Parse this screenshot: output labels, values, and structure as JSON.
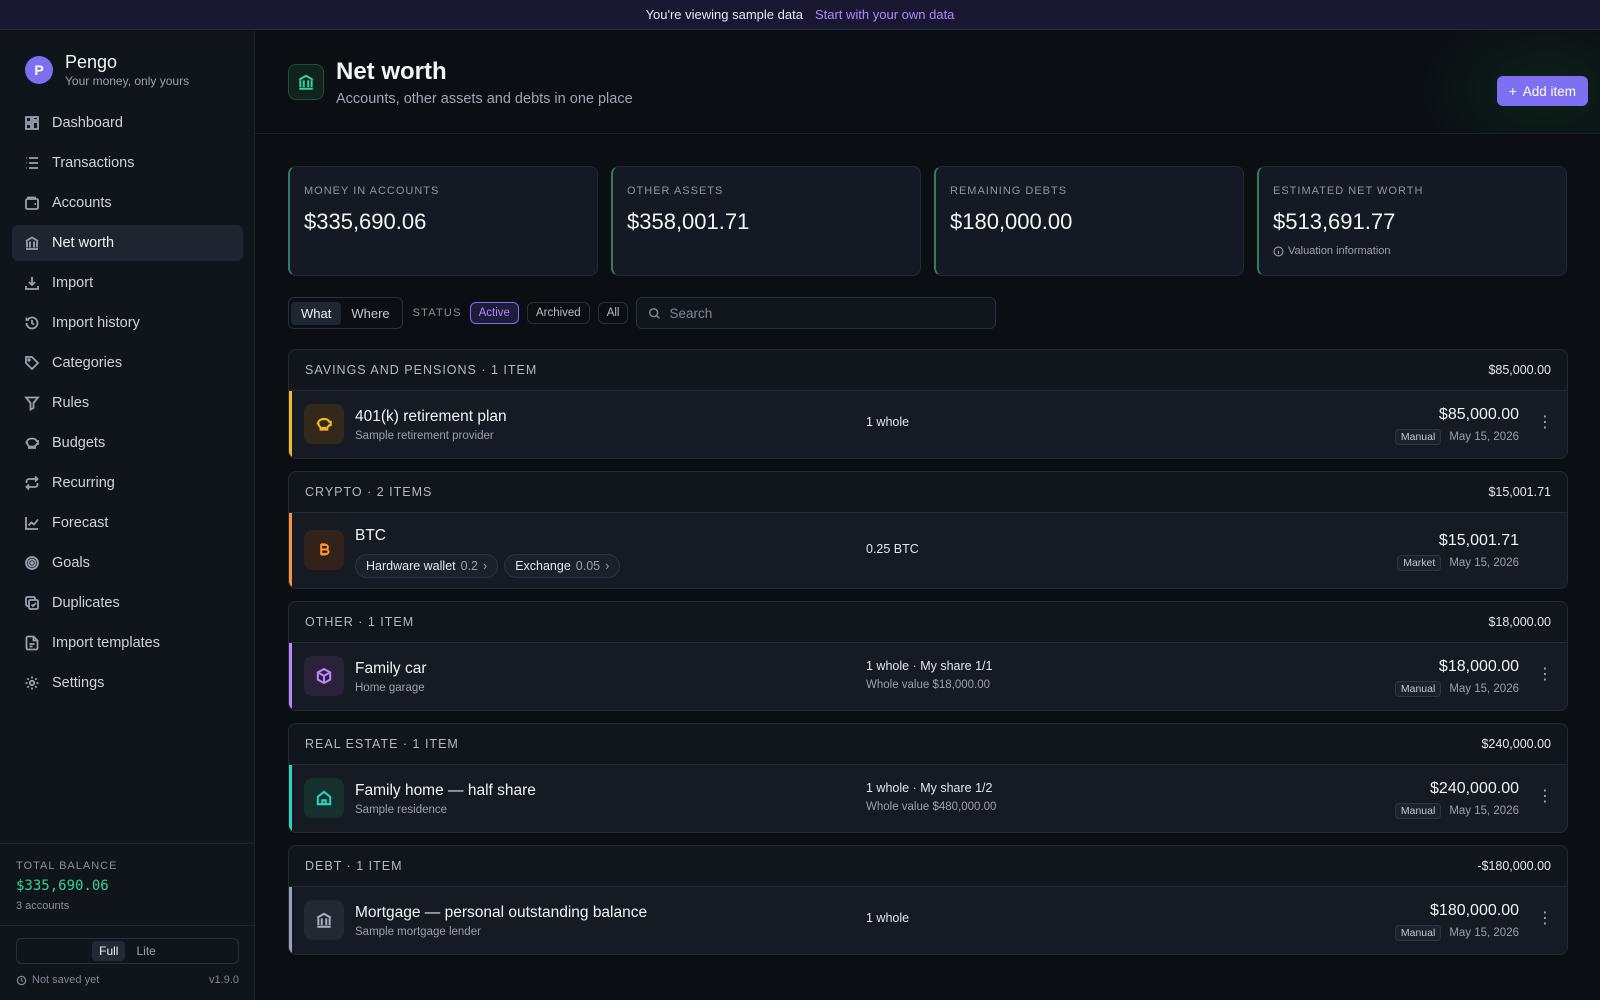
{
  "banner": {
    "text": "You're viewing sample data",
    "link": "Start with your own data"
  },
  "brand": {
    "logo_letter": "P",
    "name": "Pengo",
    "tagline": "Your money, only yours"
  },
  "nav": [
    {
      "label": "Dashboard",
      "icon": "dashboard-icon"
    },
    {
      "label": "Transactions",
      "icon": "list-icon"
    },
    {
      "label": "Accounts",
      "icon": "wallet-icon"
    },
    {
      "label": "Net worth",
      "icon": "bank-icon",
      "active": true
    },
    {
      "label": "Import",
      "icon": "download-icon"
    },
    {
      "label": "Import history",
      "icon": "history-icon"
    },
    {
      "label": "Categories",
      "icon": "tag-icon"
    },
    {
      "label": "Rules",
      "icon": "filter-icon"
    },
    {
      "label": "Budgets",
      "icon": "piggy-bank-icon"
    },
    {
      "label": "Recurring",
      "icon": "repeat-icon"
    },
    {
      "label": "Forecast",
      "icon": "chart-line-icon"
    },
    {
      "label": "Goals",
      "icon": "target-icon"
    },
    {
      "label": "Duplicates",
      "icon": "copy-check-icon"
    },
    {
      "label": "Import templates",
      "icon": "file-template-icon"
    },
    {
      "label": "Settings",
      "icon": "gear-icon"
    }
  ],
  "sidebar_bottom": {
    "total_label": "TOTAL BALANCE",
    "total_value": "$335,690.06",
    "accounts_count": "3 accounts",
    "mode_full": "Full",
    "mode_lite": "Lite",
    "save_status": "Not saved yet",
    "version": "v1.9.0"
  },
  "header": {
    "title": "Net worth",
    "subtitle": "Accounts, other assets and debts in one place",
    "add_button": "Add item"
  },
  "stats": [
    {
      "label": "MONEY IN ACCOUNTS",
      "value": "$335,690.06"
    },
    {
      "label": "OTHER ASSETS",
      "value": "$358,001.71"
    },
    {
      "label": "REMAINING DEBTS",
      "value": "$180,000.00"
    },
    {
      "label": "ESTIMATED NET WORTH",
      "value": "$513,691.77",
      "note": "Valuation information"
    }
  ],
  "filters": {
    "view_what": "What",
    "view_where": "Where",
    "status_label": "STATUS",
    "status_active": "Active",
    "status_archived": "Archived",
    "status_all": "All",
    "search_placeholder": "Search"
  },
  "groups": [
    {
      "title": "SAVINGS AND PENSIONS · 1 ITEM",
      "total": "$85,000.00",
      "item": {
        "name": "401(k) retirement plan",
        "sub": "Sample retirement provider",
        "qty": "1 whole",
        "amount": "$85,000.00",
        "source": "Manual",
        "date": "May 15, 2026",
        "color": "#f5b82a",
        "icon": "piggy-bank-icon"
      }
    },
    {
      "title": "CRYPTO · 2 ITEMS",
      "total": "$15,001.71",
      "item": {
        "name": "BTC",
        "qty": "0.25 BTC",
        "amount": "$15,001.71",
        "source": "Market",
        "date": "May 15, 2026",
        "color": "#fb923c",
        "icon": "bitcoin-icon",
        "chips": [
          {
            "label": "Hardware wallet",
            "qty": "0.2"
          },
          {
            "label": "Exchange",
            "qty": "0.05"
          }
        ]
      }
    },
    {
      "title": "OTHER · 1 ITEM",
      "total": "$18,000.00",
      "item": {
        "name": "Family car",
        "sub": "Home garage",
        "qty": "1 whole · My share 1/1",
        "qty_sub": "Whole value $18,000.00",
        "amount": "$18,000.00",
        "source": "Manual",
        "date": "May 15, 2026",
        "color": "#c084fc",
        "icon": "box-icon"
      }
    },
    {
      "title": "REAL ESTATE · 1 ITEM",
      "total": "$240,000.00",
      "item": {
        "name": "Family home — half share",
        "sub": "Sample residence",
        "qty": "1 whole · My share 1/2",
        "qty_sub": "Whole value $480,000.00",
        "amount": "$240,000.00",
        "source": "Manual",
        "date": "May 15, 2026",
        "color": "#2dd4bf",
        "icon": "house-icon"
      }
    },
    {
      "title": "DEBT · 1 ITEM",
      "total": "-$180,000.00",
      "item": {
        "name": "Mortgage — personal outstanding balance",
        "sub": "Sample mortgage lender",
        "qty": "1 whole",
        "amount": "$180,000.00",
        "source": "Manual",
        "date": "May 15, 2026",
        "color": "#94a3b8",
        "icon": "bank-icon"
      }
    }
  ]
}
